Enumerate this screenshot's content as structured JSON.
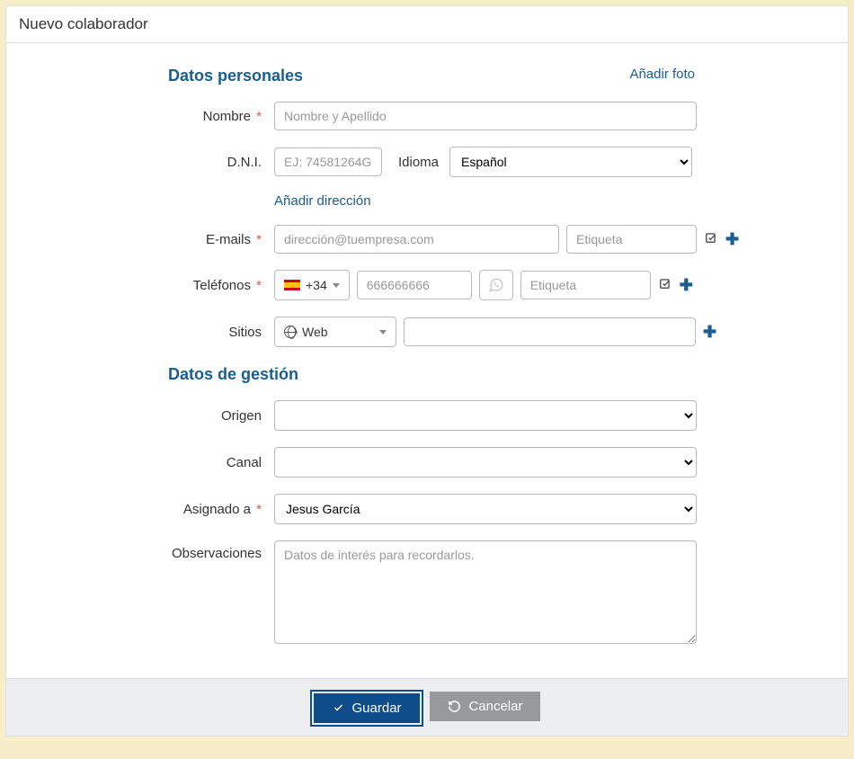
{
  "title": "Nuevo colaborador",
  "sections": {
    "personal": "Datos personales",
    "management": "Datos de gestión"
  },
  "addPhoto": "Añadir foto",
  "addAddress": "Añadir dirección",
  "labels": {
    "nombre": "Nombre",
    "dni": "D.N.I.",
    "idioma": "Idioma",
    "emails": "E-mails",
    "telefonos": "Teléfonos",
    "sitios": "Sitios",
    "origen": "Origen",
    "canal": "Canal",
    "asignado": "Asignado a",
    "observaciones": "Observaciones"
  },
  "placeholders": {
    "nombre": "Nombre y Apellido",
    "dni": "EJ: 74581264G",
    "email": "dirección@tuempresa.com",
    "etiqueta": "Etiqueta",
    "telefono": "666666666",
    "observaciones": "Datos de interés para recordarlos."
  },
  "siteType": "Web",
  "countryCode": "+34",
  "idiomaOptions": [
    "Español"
  ],
  "idiomaValue": "Español",
  "origenOptions": [
    ""
  ],
  "canalOptions": [
    ""
  ],
  "asignadoOptions": [
    "Jesus García"
  ],
  "asignadoValue": "Jesus García",
  "buttons": {
    "save": "Guardar",
    "cancel": "Cancelar"
  }
}
